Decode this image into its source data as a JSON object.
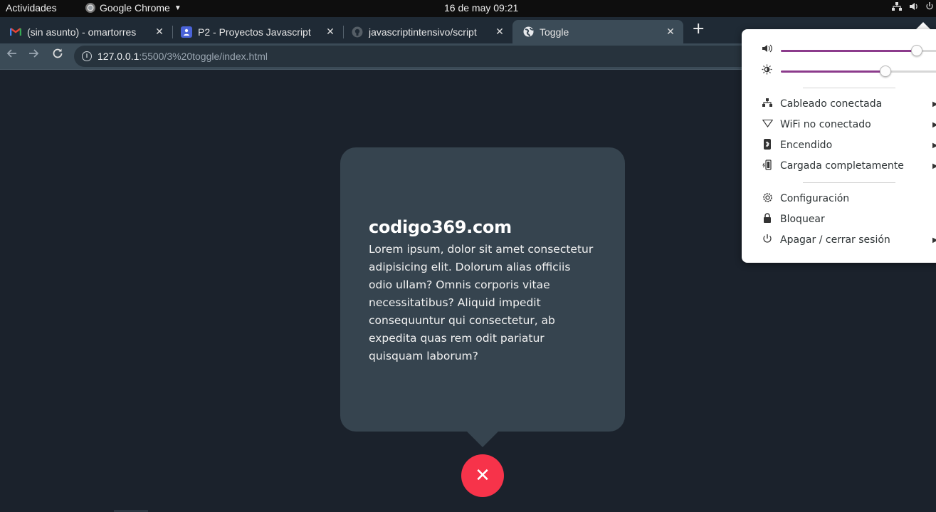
{
  "topbar": {
    "activities": "Actividades",
    "app_name": "Google Chrome",
    "clock": "16 de may  09:21"
  },
  "tabs": [
    {
      "title": "(sin asunto) - omartorres",
      "favicon": "gmail-icon",
      "active": false
    },
    {
      "title": "P2 - Proyectos Javascript",
      "favicon": "classroom-icon",
      "active": false
    },
    {
      "title": "javascriptintensivo/script",
      "favicon": "github-icon",
      "active": false
    },
    {
      "title": "Toggle",
      "favicon": "globe-icon",
      "active": true
    }
  ],
  "toolbar": {
    "url_host": "127.0.0.1",
    "url_path": ":5500/3%20toggle/index.html"
  },
  "page": {
    "brand": "codigo369.com",
    "body": "Lorem ipsum, dolor sit amet consectetur adipisicing elit. Dolorum alias officiis odio ullam? Omnis corporis vitae necessitatibus? Aliquid impedit consequuntur qui consectetur, ab expedita quas rem odit pariatur quisquam laborum?",
    "close_glyph": "✕"
  },
  "system_menu": {
    "volume_level": 0.83,
    "brightness_level": 0.64,
    "items_network": [
      {
        "icon": "wired-network-icon",
        "label": "Cableado conectada",
        "submenu": true
      },
      {
        "icon": "wifi-icon",
        "label": "WiFi no conectado",
        "submenu": true
      },
      {
        "icon": "bluetooth-icon",
        "label": "Encendido",
        "submenu": true
      },
      {
        "icon": "battery-icon",
        "label": "Cargada completamente",
        "submenu": true
      }
    ],
    "items_system": [
      {
        "icon": "settings-icon",
        "label": "Configuración",
        "submenu": false
      },
      {
        "icon": "lock-icon",
        "label": "Bloquear",
        "submenu": false
      },
      {
        "icon": "power-icon",
        "label": "Apagar / cerrar sesión",
        "submenu": true
      }
    ]
  },
  "colors": {
    "page_background": "#1b222c",
    "card": "#36444f",
    "close_button": "#f7334a",
    "slider_accent": "#8c3b8c"
  }
}
